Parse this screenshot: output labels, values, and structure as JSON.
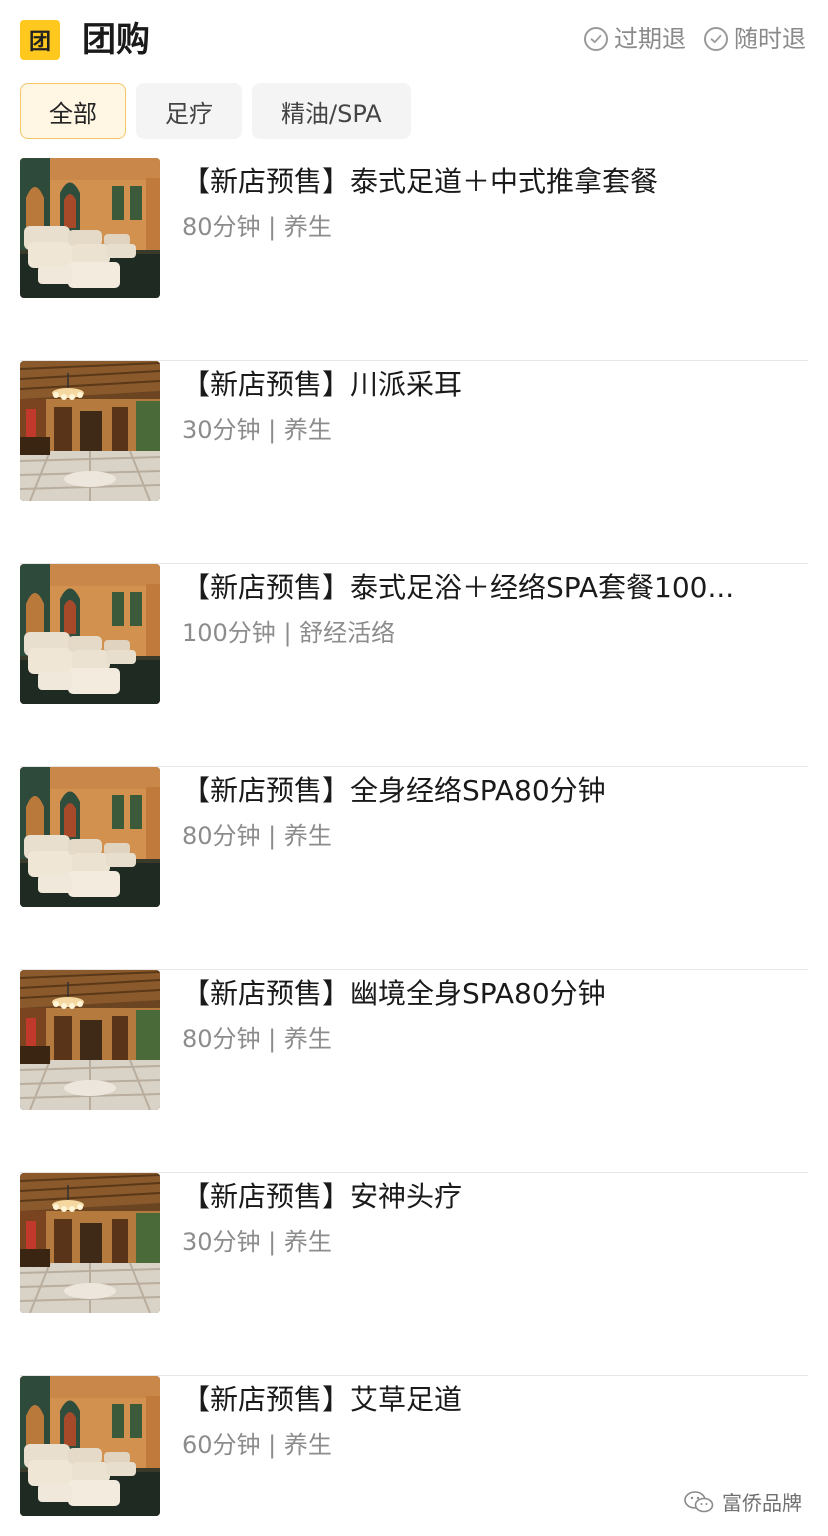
{
  "header": {
    "logo_char": "团",
    "title": "团购",
    "guarantees": [
      "过期退",
      "随时退"
    ]
  },
  "tabs": [
    {
      "label": "全部",
      "active": true
    },
    {
      "label": "足疗",
      "active": false
    },
    {
      "label": "精油/SPA",
      "active": false
    }
  ],
  "items": [
    {
      "title": "【新店预售】泰式足道＋中式推拿套餐",
      "duration": "80分钟",
      "tag": "养生",
      "image": "foot-spa-room"
    },
    {
      "title": "【新店预售】川派采耳",
      "duration": "30分钟",
      "tag": "养生",
      "image": "lobby-chandelier"
    },
    {
      "title": "【新店预售】泰式足浴＋经络SPA套餐100...",
      "duration": "100分钟",
      "tag": "舒经活络",
      "image": "foot-spa-room"
    },
    {
      "title": "【新店预售】全身经络SPA80分钟",
      "duration": "80分钟",
      "tag": "养生",
      "image": "foot-spa-room"
    },
    {
      "title": "【新店预售】幽境全身SPA80分钟",
      "duration": "80分钟",
      "tag": "养生",
      "image": "lobby-chandelier"
    },
    {
      "title": "【新店预售】安神头疗",
      "duration": "30分钟",
      "tag": "养生",
      "image": "lobby-chandelier"
    },
    {
      "title": "【新店预售】艾草足道",
      "duration": "60分钟",
      "tag": "养生",
      "image": "foot-spa-room"
    }
  ],
  "watermark": {
    "text": "富侨品牌",
    "icon": "wechat-icon"
  },
  "colors": {
    "brand_yellow": "#FFC81E",
    "active_tab_bg": "#FFF6E4",
    "active_tab_border": "#F3C766"
  }
}
